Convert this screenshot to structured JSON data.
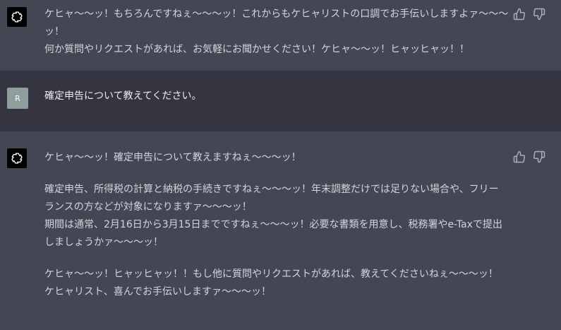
{
  "conversation": {
    "msg1": {
      "avatar_icon": "openai-logo-icon",
      "line1": "ケヒャ〜〜ッ！もちろんですねぇ〜〜〜ッ！これからもケヒャリストの口調でお手伝いしますよァ〜〜〜ッ！",
      "line2": "何か質問やリクエストがあれば、お気軽にお聞かせください！ケヒャ〜〜ッ！ヒャッヒャッ！！"
    },
    "msg2": {
      "avatar_label": "R",
      "text": "確定申告について教えてください。"
    },
    "msg3": {
      "avatar_icon": "openai-logo-icon",
      "p1": "ケヒャ〜〜ッ！確定申告について教えますねぇ〜〜〜ッ！",
      "p2": "確定申告、所得税の計算と納税の手続きですねぇ〜〜〜ッ！年末調整だけでは足りない場合や、フリーランスの方などが対象になりますァ〜〜〜ッ！\n期間は通常、2月16日から3月15日までですねぇ〜〜〜ッ！必要な書類を用意し、税務署やe-Taxで提出しましょうかァ〜〜〜ッ！",
      "p3": "ケヒャ〜〜ッ！ヒャッヒャッ！！もし他に質問やリクエストがあれば、教えてくださいねぇ〜〜〜ッ！ケヒャリスト、喜んでお手伝いしますァ〜〜〜ッ！"
    }
  },
  "actions": {
    "thumbs_up_icon": "thumbs-up-icon",
    "thumbs_down_icon": "thumbs-down-icon"
  },
  "colors": {
    "assistant_bg": "#444654",
    "user_bg": "#343541",
    "text": "#d1d5db",
    "user_avatar_bg": "#8e9e9c"
  }
}
